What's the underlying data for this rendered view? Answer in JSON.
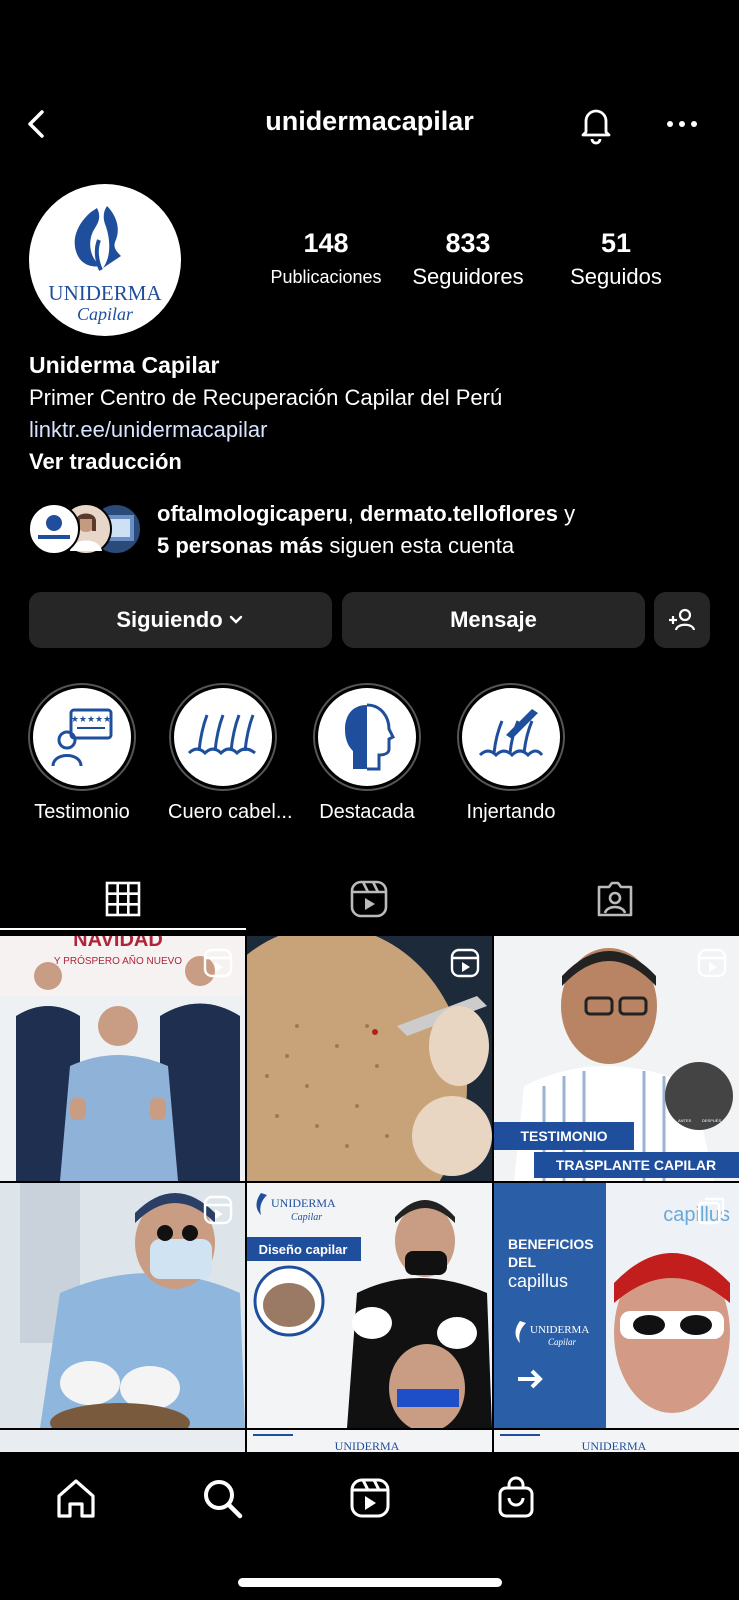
{
  "header": {
    "username": "unidermacapilar"
  },
  "profile": {
    "avatar_text_1": "UNIDERMA",
    "avatar_text_2": "Capilar",
    "stats": [
      {
        "num": "148",
        "label": "Publicaciones"
      },
      {
        "num": "833",
        "label": "Seguidores"
      },
      {
        "num": "51",
        "label": "Seguidos"
      }
    ],
    "name": "Uniderma Capilar",
    "bio": "Primer Centro de Recuperación Capilar del Perú",
    "link": "linktr.ee/unidermacapilar",
    "translate": "Ver traducción",
    "mutual": {
      "user1": "oftalmologicaperu",
      "sep": ", ",
      "user2": "dermato.telloflores",
      "and": " y",
      "more": "5 personas más",
      "tail": " siguen esta cuenta"
    }
  },
  "actions": {
    "following": "Siguiendo",
    "message": "Mensaje"
  },
  "highlights": [
    {
      "label": "Testimonio"
    },
    {
      "label": "Cuero cabel..."
    },
    {
      "label": "Destacada"
    },
    {
      "label": "Injertando"
    }
  ],
  "posts": {
    "p1_top": "NAVIDAD",
    "p1_sub": "Y PRÓSPERO AÑO NUEVO",
    "p3_tag1": "TESTIMONIO",
    "p3_tag2": "TRASPLANTE CAPILAR",
    "p3_small1": "ANTES",
    "p3_small2": "DESPUÉS",
    "p5_brand": "UNIDERMA",
    "p5_brand2": "Capilar",
    "p5_tag": "Diseño capilar",
    "p6_title1": "BENEFICIOS",
    "p6_title2": "DEL",
    "p6_title3": "capillus",
    "p6_brand": "UNIDERMA",
    "p6_brand2": "Capilar",
    "p6_top": "capillus",
    "p7_brand": "UNIDERMA",
    "p8_brand": "UNIDERMA"
  },
  "colors": {
    "brand_blue": "#1f4f9c",
    "button_bg": "#262626",
    "link": "#d8e4ff"
  }
}
